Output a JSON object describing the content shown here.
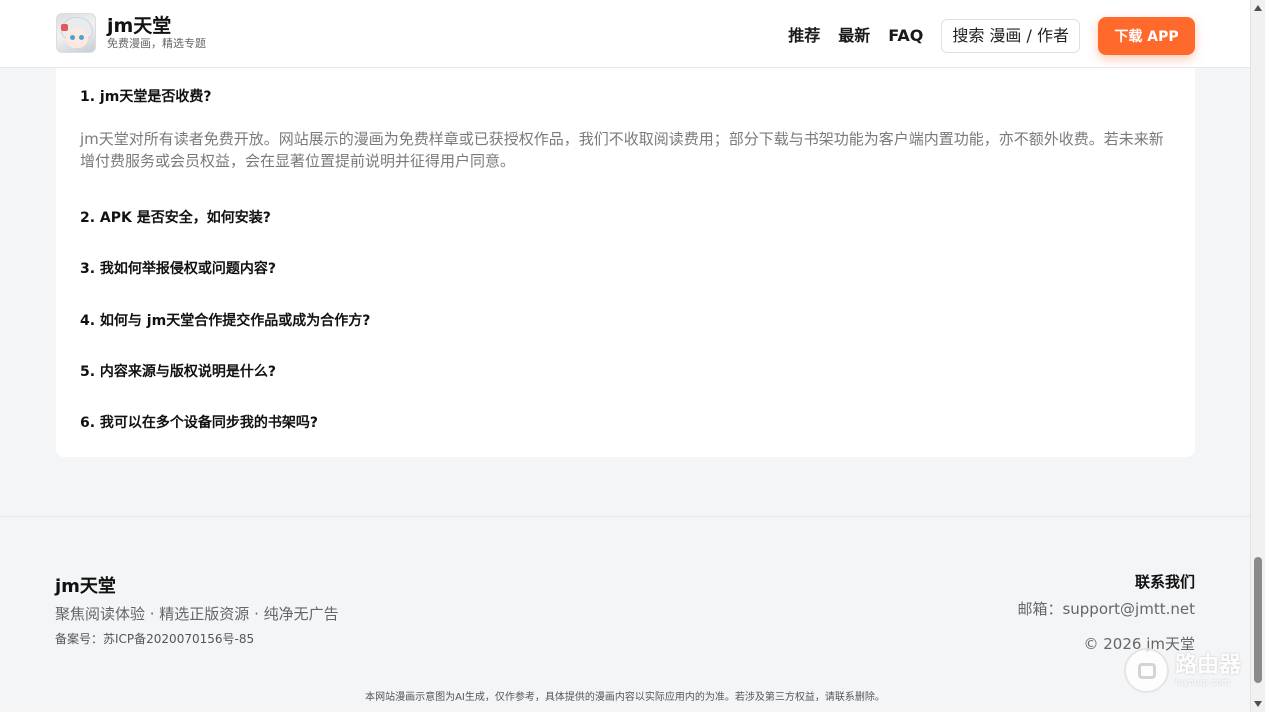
{
  "header": {
    "logo_title": "jm天堂",
    "logo_subtitle": "免费漫画，精选专题",
    "nav": [
      "推荐",
      "最新",
      "FAQ"
    ],
    "search_label": "搜索 漫画 / 作者",
    "download_label": "下载 APP"
  },
  "faq": {
    "items": [
      {
        "question": "1. jm天堂是否收费?",
        "answer": "jm天堂对所有读者免费开放。网站展示的漫画为免费样章或已获授权作品，我们不收取阅读费用；部分下载与书架功能为客户端内置功能，亦不额外收费。若未来新增付费服务或会员权益，会在显著位置提前说明并征得用户同意。"
      },
      {
        "question": "2. APK 是否安全，如何安装?"
      },
      {
        "question": "3. 我如何举报侵权或问题内容?"
      },
      {
        "question": "4. 如何与 jm天堂合作提交作品或成为合作方?"
      },
      {
        "question": "5. 内容来源与版权说明是什么?"
      },
      {
        "question": "6. 我可以在多个设备同步我的书架吗?"
      }
    ]
  },
  "footer": {
    "brand": "jm天堂",
    "slogan": "聚焦阅读体验 · 精选正版资源 · 纯净无广告",
    "icp": "备案号：苏ICP备2020070156号-85",
    "contact_title": "联系我们",
    "email": "邮箱：support@jmtt.net",
    "copyright": "© 2026 jm天堂",
    "disclaimer": "本网站漫画示意图为AI生成，仅作参考，具体提供的漫画内容以实际应用内的为准。若涉及第三方权益，请联系删除。"
  },
  "watermark": {
    "title": "路由器",
    "sub": "luyouqi.com"
  },
  "colors": {
    "accent": "#ff6a2c",
    "background": "#f4f5f7"
  }
}
